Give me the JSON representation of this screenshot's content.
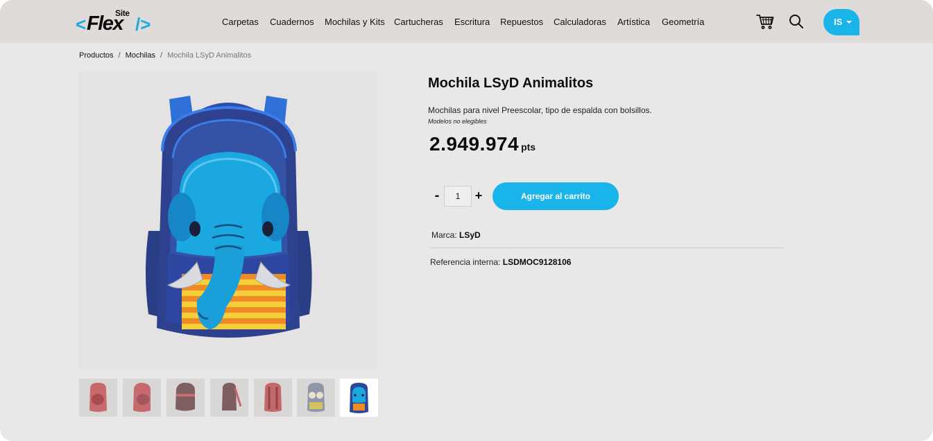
{
  "header": {
    "logo": {
      "site": "Site",
      "brand": "Flex",
      "open": "<",
      "close": "/>"
    },
    "nav": [
      "Carpetas",
      "Cuadernos",
      "Mochilas y Kits",
      "Cartucheras",
      "Escritura",
      "Repuestos",
      "Calculadoras",
      "Artística",
      "Geometría"
    ],
    "user_initials": "IS",
    "icons": {
      "cart": "cart-icon",
      "search": "search-icon",
      "user_menu": "chevron-down-icon"
    },
    "accent_color": "#19b4ea"
  },
  "breadcrumb": {
    "items": [
      "Productos",
      "Mochilas"
    ],
    "current": "Mochila LSyD Animalitos",
    "separator": "/"
  },
  "product": {
    "title": "Mochila LSyD Animalitos",
    "description": "Mochilas para nivel Preescolar, tipo de espalda con bolsillos.",
    "note": "Modelos no elegibles",
    "price": "2.949.974",
    "price_unit": "pts",
    "quantity": "1",
    "qty_minus": "-",
    "qty_plus": "+",
    "add_to_cart": "Agregar al carrito",
    "brand_label": "Marca:",
    "brand": "LSyD",
    "reference_label": "Referencia interna:",
    "reference": "LSDMOC9128106",
    "thumbnail_count": 7,
    "selected_thumbnail": 7
  }
}
